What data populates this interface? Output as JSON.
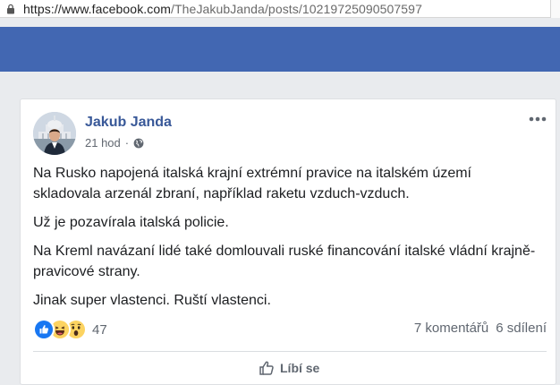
{
  "browser": {
    "url_domain": "https://www.facebook.com",
    "url_path": "/TheJakubJanda/posts/10219725090507597"
  },
  "post": {
    "author": "Jakub Janda",
    "timestamp": "21 hod",
    "separator": "·",
    "privacy_icon": "globe-icon",
    "more_icon": "ellipsis-icon",
    "paragraphs": [
      "Na Rusko napojená italská krajní extrémní pravice na italském území skladovala arzenál zbraní, například raketu vzduch-vzduch.",
      "Už je pozavírala italská policie.",
      "Na Kreml navázaní lidé také domlouvali ruské financování italské vládní krajně-pravicové strany.",
      "Jinak super vlastenci. Ruští vlastenci."
    ]
  },
  "stats": {
    "reactions": [
      "like-icon",
      "haha-icon",
      "wow-icon"
    ],
    "reaction_count": "47",
    "comments": "7 komentářů",
    "shares": "6 sdílení"
  },
  "actions": {
    "like_label": "Líbí se"
  },
  "colors": {
    "header_blue": "#4267b2",
    "author_link": "#385898",
    "like_blue": "#1877f2",
    "reaction_yellow": "#fcd361"
  }
}
